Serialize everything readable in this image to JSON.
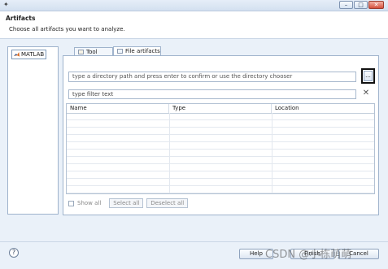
{
  "window": {
    "app_icon": "wand-icon",
    "controls": [
      "minimize-icon",
      "maximize-icon",
      "close-icon"
    ]
  },
  "header": {
    "title": "Artifacts",
    "description": "Choose all artifacts you want to analyze."
  },
  "sidebar": {
    "items": [
      {
        "label": "MATLAB",
        "icon": "matlab-icon"
      }
    ]
  },
  "tabs": [
    {
      "label": "Tool artifacts",
      "icon": "folder-icon",
      "selected": false
    },
    {
      "label": "File artifacts",
      "icon": "file-icon",
      "selected": true
    }
  ],
  "directory": {
    "placeholder": "type a directory path and press enter to confirm or use the directory chooser",
    "browse_label": "..."
  },
  "filter": {
    "placeholder": "type filter text",
    "clear_icon": "clear-x-icon"
  },
  "table": {
    "columns": [
      "Name",
      "Type",
      "Location"
    ],
    "rows": []
  },
  "controls": {
    "show_all_label": "Show all",
    "select_all_label": "Select all",
    "deselect_all_label": "Deselect all"
  },
  "footer": {
    "help_icon": "help-icon",
    "help_label": "Help",
    "finish_label": "Finish",
    "cancel_label": "Cancel"
  },
  "watermark": "CSDN @小栋萌萌"
}
